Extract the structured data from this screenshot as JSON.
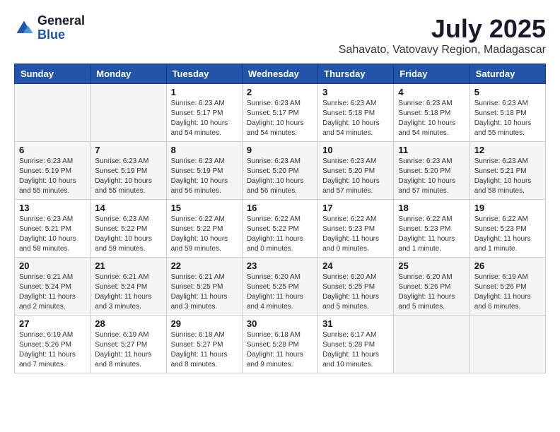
{
  "header": {
    "logo_general": "General",
    "logo_blue": "Blue",
    "month_year": "July 2025",
    "location": "Sahavato, Vatovavy Region, Madagascar"
  },
  "weekdays": [
    "Sunday",
    "Monday",
    "Tuesday",
    "Wednesday",
    "Thursday",
    "Friday",
    "Saturday"
  ],
  "weeks": [
    [
      null,
      null,
      {
        "day": 1,
        "sunrise": "6:23 AM",
        "sunset": "5:17 PM",
        "daylight": "10 hours and 54 minutes."
      },
      {
        "day": 2,
        "sunrise": "6:23 AM",
        "sunset": "5:17 PM",
        "daylight": "10 hours and 54 minutes."
      },
      {
        "day": 3,
        "sunrise": "6:23 AM",
        "sunset": "5:18 PM",
        "daylight": "10 hours and 54 minutes."
      },
      {
        "day": 4,
        "sunrise": "6:23 AM",
        "sunset": "5:18 PM",
        "daylight": "10 hours and 54 minutes."
      },
      {
        "day": 5,
        "sunrise": "6:23 AM",
        "sunset": "5:18 PM",
        "daylight": "10 hours and 55 minutes."
      }
    ],
    [
      {
        "day": 6,
        "sunrise": "6:23 AM",
        "sunset": "5:19 PM",
        "daylight": "10 hours and 55 minutes."
      },
      {
        "day": 7,
        "sunrise": "6:23 AM",
        "sunset": "5:19 PM",
        "daylight": "10 hours and 55 minutes."
      },
      {
        "day": 8,
        "sunrise": "6:23 AM",
        "sunset": "5:19 PM",
        "daylight": "10 hours and 56 minutes."
      },
      {
        "day": 9,
        "sunrise": "6:23 AM",
        "sunset": "5:20 PM",
        "daylight": "10 hours and 56 minutes."
      },
      {
        "day": 10,
        "sunrise": "6:23 AM",
        "sunset": "5:20 PM",
        "daylight": "10 hours and 57 minutes."
      },
      {
        "day": 11,
        "sunrise": "6:23 AM",
        "sunset": "5:20 PM",
        "daylight": "10 hours and 57 minutes."
      },
      {
        "day": 12,
        "sunrise": "6:23 AM",
        "sunset": "5:21 PM",
        "daylight": "10 hours and 58 minutes."
      }
    ],
    [
      {
        "day": 13,
        "sunrise": "6:23 AM",
        "sunset": "5:21 PM",
        "daylight": "10 hours and 58 minutes."
      },
      {
        "day": 14,
        "sunrise": "6:23 AM",
        "sunset": "5:22 PM",
        "daylight": "10 hours and 59 minutes."
      },
      {
        "day": 15,
        "sunrise": "6:22 AM",
        "sunset": "5:22 PM",
        "daylight": "10 hours and 59 minutes."
      },
      {
        "day": 16,
        "sunrise": "6:22 AM",
        "sunset": "5:22 PM",
        "daylight": "11 hours and 0 minutes."
      },
      {
        "day": 17,
        "sunrise": "6:22 AM",
        "sunset": "5:23 PM",
        "daylight": "11 hours and 0 minutes."
      },
      {
        "day": 18,
        "sunrise": "6:22 AM",
        "sunset": "5:23 PM",
        "daylight": "11 hours and 1 minute."
      },
      {
        "day": 19,
        "sunrise": "6:22 AM",
        "sunset": "5:23 PM",
        "daylight": "11 hours and 1 minute."
      }
    ],
    [
      {
        "day": 20,
        "sunrise": "6:21 AM",
        "sunset": "5:24 PM",
        "daylight": "11 hours and 2 minutes."
      },
      {
        "day": 21,
        "sunrise": "6:21 AM",
        "sunset": "5:24 PM",
        "daylight": "11 hours and 3 minutes."
      },
      {
        "day": 22,
        "sunrise": "6:21 AM",
        "sunset": "5:25 PM",
        "daylight": "11 hours and 3 minutes."
      },
      {
        "day": 23,
        "sunrise": "6:20 AM",
        "sunset": "5:25 PM",
        "daylight": "11 hours and 4 minutes."
      },
      {
        "day": 24,
        "sunrise": "6:20 AM",
        "sunset": "5:25 PM",
        "daylight": "11 hours and 5 minutes."
      },
      {
        "day": 25,
        "sunrise": "6:20 AM",
        "sunset": "5:26 PM",
        "daylight": "11 hours and 5 minutes."
      },
      {
        "day": 26,
        "sunrise": "6:19 AM",
        "sunset": "5:26 PM",
        "daylight": "11 hours and 6 minutes."
      }
    ],
    [
      {
        "day": 27,
        "sunrise": "6:19 AM",
        "sunset": "5:26 PM",
        "daylight": "11 hours and 7 minutes."
      },
      {
        "day": 28,
        "sunrise": "6:19 AM",
        "sunset": "5:27 PM",
        "daylight": "11 hours and 8 minutes."
      },
      {
        "day": 29,
        "sunrise": "6:18 AM",
        "sunset": "5:27 PM",
        "daylight": "11 hours and 8 minutes."
      },
      {
        "day": 30,
        "sunrise": "6:18 AM",
        "sunset": "5:28 PM",
        "daylight": "11 hours and 9 minutes."
      },
      {
        "day": 31,
        "sunrise": "6:17 AM",
        "sunset": "5:28 PM",
        "daylight": "11 hours and 10 minutes."
      },
      null,
      null
    ]
  ]
}
